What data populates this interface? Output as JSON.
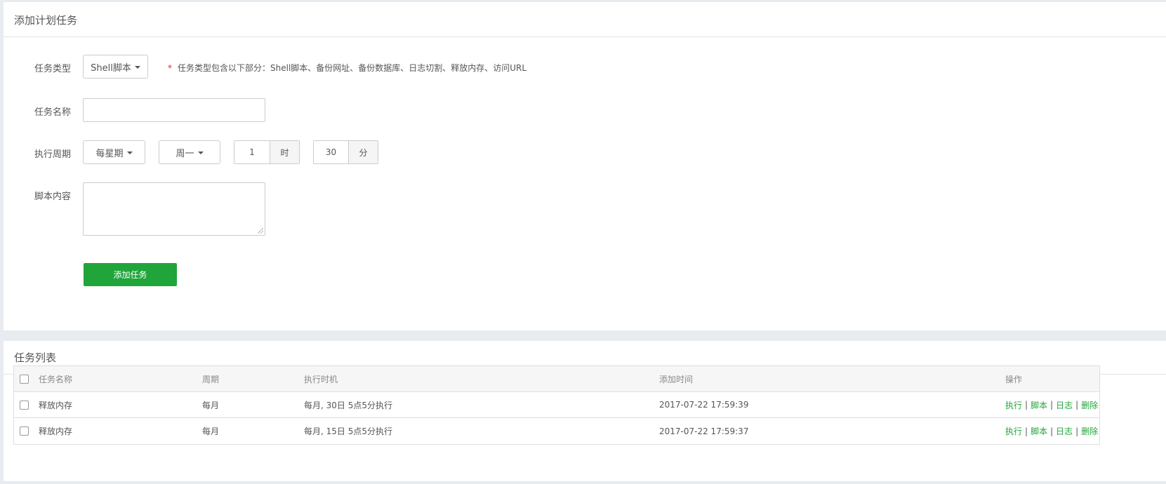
{
  "add_panel": {
    "title": "添加计划任务",
    "task_type": {
      "label": "任务类型",
      "selected": "Shell脚本",
      "hint_mark": "*",
      "hint": "任务类型包含以下部分：Shell脚本、备份网址、备份数据库、日志切割、释放内存、访问URL"
    },
    "task_name": {
      "label": "任务名称",
      "value": ""
    },
    "cycle": {
      "label": "执行周期",
      "period": "每星期",
      "weekday": "周一",
      "hour": "1",
      "hour_unit": "时",
      "minute": "30",
      "minute_unit": "分"
    },
    "script": {
      "label": "脚本内容",
      "value": ""
    },
    "submit_label": "添加任务"
  },
  "list_panel": {
    "title": "任务列表",
    "columns": [
      "任务名称",
      "周期",
      "执行时机",
      "添加时间",
      "操作"
    ],
    "rows": [
      {
        "name": "释放内存",
        "cycle": "每月",
        "timing": "每月, 30日 5点5分执行",
        "added": "2017-07-22 17:59:39"
      },
      {
        "name": "释放内存",
        "cycle": "每月",
        "timing": "每月, 15日 5点5分执行",
        "added": "2017-07-22 17:59:37"
      }
    ],
    "actions": {
      "run": "执行",
      "script": "脚本",
      "log": "日志",
      "delete": "删除",
      "sep": "|"
    }
  },
  "colors": {
    "accent": "#20a53a",
    "required": "#e3251f",
    "page_bg": "#e8ebef"
  }
}
